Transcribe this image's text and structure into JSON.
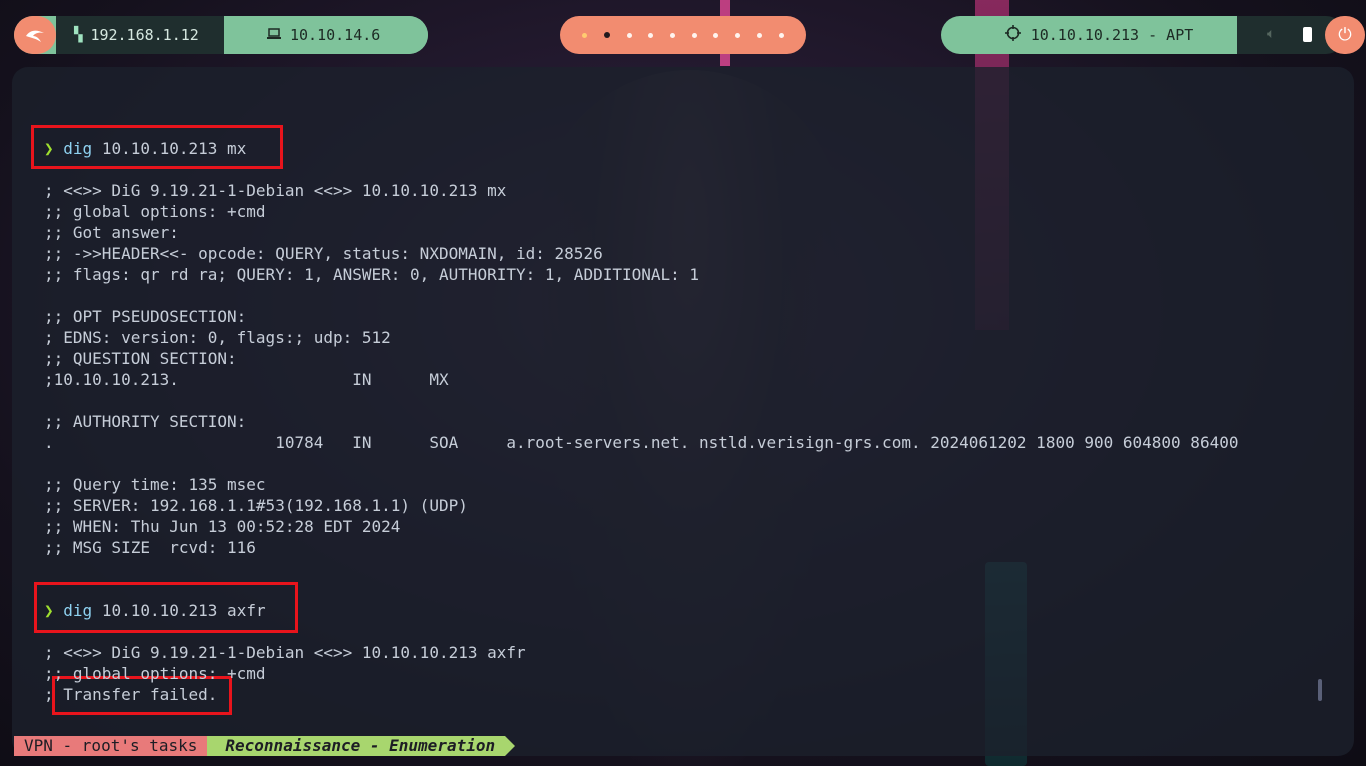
{
  "topbar": {
    "launcher_icon": "kali-dragon-icon",
    "lan_icon": "ethernet-icon",
    "lan_ip": "192.168.1.12",
    "vpn_icon": "laptop-icon",
    "vpn_ip": "10.10.14.6",
    "workspaces_count": 10,
    "active_workspace_index": 1,
    "target_icon": "crosshair-icon",
    "target_label": "10.10.10.213 - APT",
    "volume_icon": "volume-icon",
    "battery_icon": "battery-icon",
    "power_icon": "power-icon",
    "colors": {
      "green": "#7fc39b",
      "orange": "#f28c70",
      "dark": "#1f2e2e"
    }
  },
  "terminal": {
    "prompt_symbol": "❯",
    "block1": {
      "cmd": "dig",
      "args": "10.10.10.213 mx",
      "output": [
        "; <<>> DiG 9.19.21-1-Debian <<>> 10.10.10.213 mx",
        ";; global options: +cmd",
        ";; Got answer:",
        ";; ->>HEADER<<- opcode: QUERY, status: NXDOMAIN, id: 28526",
        ";; flags: qr rd ra; QUERY: 1, ANSWER: 0, AUTHORITY: 1, ADDITIONAL: 1",
        "",
        ";; OPT PSEUDOSECTION:",
        "; EDNS: version: 0, flags:; udp: 512",
        ";; QUESTION SECTION:",
        ";10.10.10.213.                  IN      MX",
        "",
        ";; AUTHORITY SECTION:",
        ".                       10784   IN      SOA     a.root-servers.net. nstld.verisign-grs.com. 2024061202 1800 900 604800 86400",
        "",
        ";; Query time: 135 msec",
        ";; SERVER: 192.168.1.1#53(192.168.1.1) (UDP)",
        ";; WHEN: Thu Jun 13 00:52:28 EDT 2024",
        ";; MSG SIZE  rcvd: 116"
      ]
    },
    "block2": {
      "cmd": "dig",
      "args": "10.10.10.213 axfr",
      "output": [
        "; <<>> DiG 9.19.21-1-Debian <<>> 10.10.10.213 axfr",
        ";; global options: +cmd",
        "; Transfer failed."
      ]
    },
    "highlight_color": "#e8141c"
  },
  "statusbar": {
    "session": "VPN - root's tasks",
    "window": "Reconnaissance - Enumeration",
    "colors": {
      "session_bg": "#e87a7a",
      "window_bg": "#a8d66e"
    }
  }
}
